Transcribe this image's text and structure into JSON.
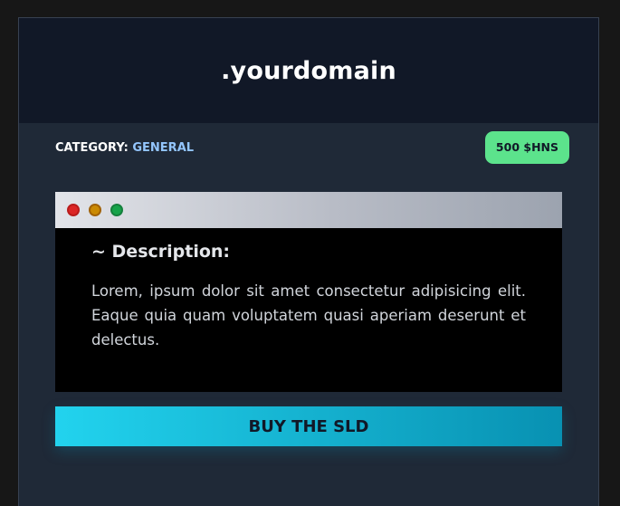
{
  "header": {
    "title": ".yourdomain"
  },
  "meta": {
    "category_label": "CATEGORY:",
    "category_value": "GENERAL",
    "price": "500 $HNS"
  },
  "window": {
    "controls": [
      "red-dot-icon",
      "yellow-dot-icon",
      "green-dot-icon"
    ],
    "heading": "~ Description:",
    "text": "Lorem, ipsum dolor sit amet consectetur adipisicing elit. Eaque quia quam voluptatem quasi aperiam deserunt et delectus."
  },
  "action": {
    "buy_label": "BUY THE SLD"
  },
  "colors": {
    "accent": "#22d3ee",
    "badge": "#5ce38c",
    "category_value": "#93c5fd"
  }
}
